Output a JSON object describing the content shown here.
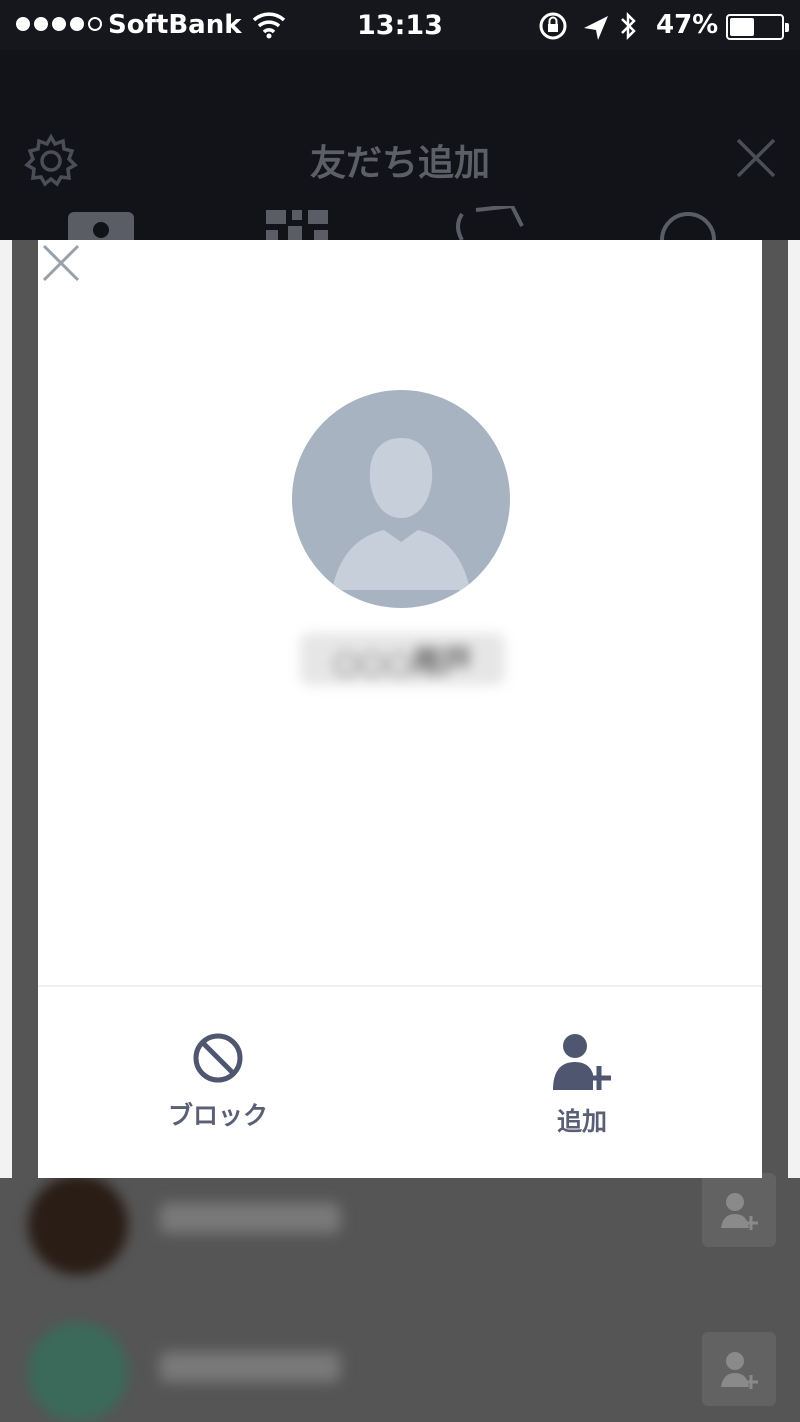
{
  "status_bar": {
    "carrier": "SoftBank",
    "time": "13:13",
    "battery_percent": "47%",
    "battery_level": 0.47,
    "icons": [
      "signal-dots-icon",
      "wifi-icon",
      "lock-rotation-icon",
      "location-arrow-icon",
      "bluetooth-icon",
      "battery-icon"
    ]
  },
  "header": {
    "title": "友だち追加",
    "left_icon": "gear-icon",
    "right_icon": "close-icon",
    "tabs": [
      "contacts-tab-icon",
      "qr-code-tab-icon",
      "shake-tab-icon",
      "search-tab-icon"
    ]
  },
  "modal": {
    "close_icon": "close-icon",
    "avatar_icon": "default-avatar-icon",
    "name": "○○○用戸",
    "actions": {
      "block_label": "ブロック",
      "add_label": "追加"
    }
  },
  "colors": {
    "header_bg": "#121319",
    "modal_bg": "#ffffff",
    "avatar_bg": "#a8b3c1",
    "action_color": "#4f5670",
    "overlay": "#4a4a4a"
  }
}
